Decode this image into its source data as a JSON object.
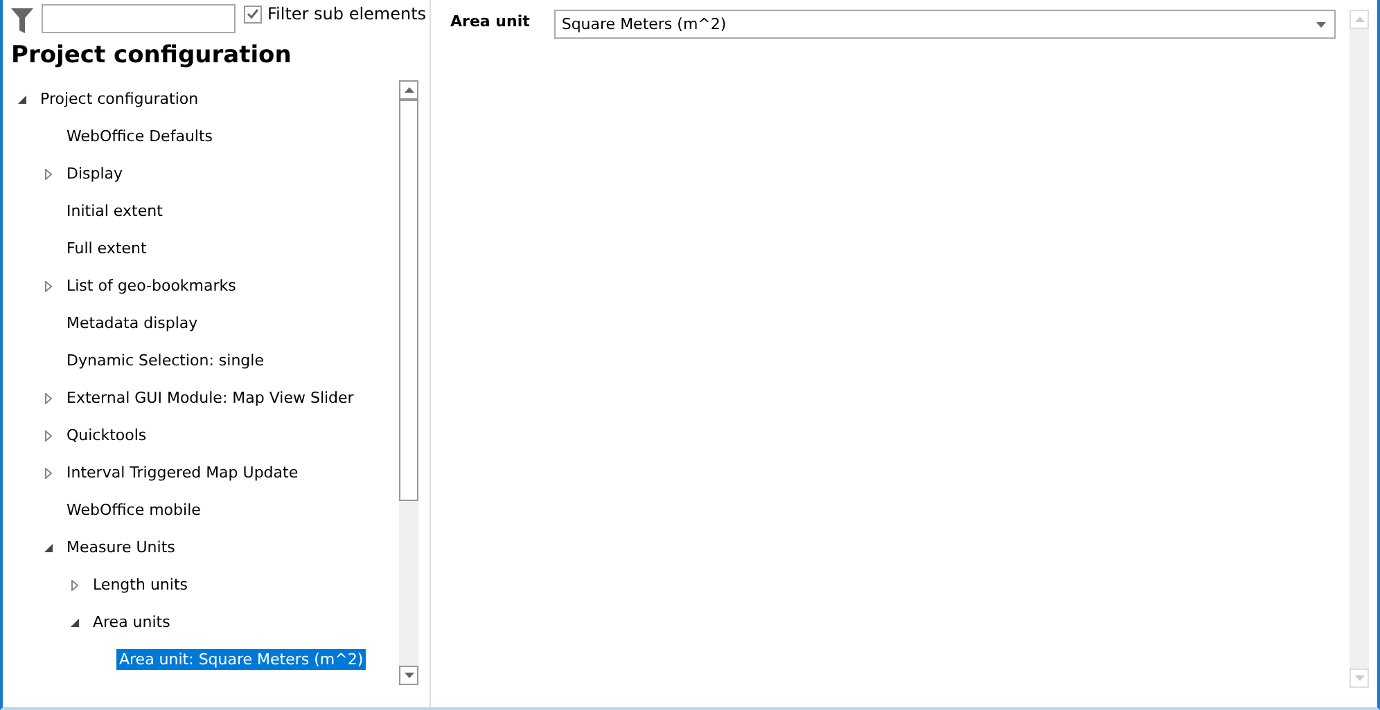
{
  "filter": {
    "checkbox": {
      "label": "Filter sub elements",
      "checked": true
    }
  },
  "panel_title": "Project configuration",
  "tree": [
    {
      "label": "Project configuration",
      "expanded": true,
      "selected": false,
      "children": [
        {
          "label": "WebOffice Defaults",
          "selected": false
        },
        {
          "label": "Display",
          "expanded": false,
          "selected": false
        },
        {
          "label": "Initial extent",
          "selected": false
        },
        {
          "label": "Full extent",
          "selected": false
        },
        {
          "label": "List of geo-bookmarks",
          "expanded": false,
          "selected": false
        },
        {
          "label": "Metadata display",
          "selected": false
        },
        {
          "label": "Dynamic Selection: single",
          "selected": false
        },
        {
          "label": "External GUI Module: Map View Slider",
          "expanded": false,
          "selected": false
        },
        {
          "label": "Quicktools",
          "expanded": false,
          "selected": false
        },
        {
          "label": "Interval Triggered Map Update",
          "expanded": false,
          "selected": false
        },
        {
          "label": "WebOffice mobile",
          "selected": false
        },
        {
          "label": "Measure Units",
          "expanded": true,
          "selected": false,
          "children": [
            {
              "label": "Length units",
              "expanded": false,
              "selected": false
            },
            {
              "label": "Area units",
              "expanded": true,
              "selected": false,
              "children": [
                {
                  "label": "Area unit: Square Meters (m^2)",
                  "selected": true
                }
              ]
            }
          ]
        }
      ]
    }
  ],
  "property": {
    "label": "Area unit",
    "value": "Square Meters (m^2)"
  }
}
